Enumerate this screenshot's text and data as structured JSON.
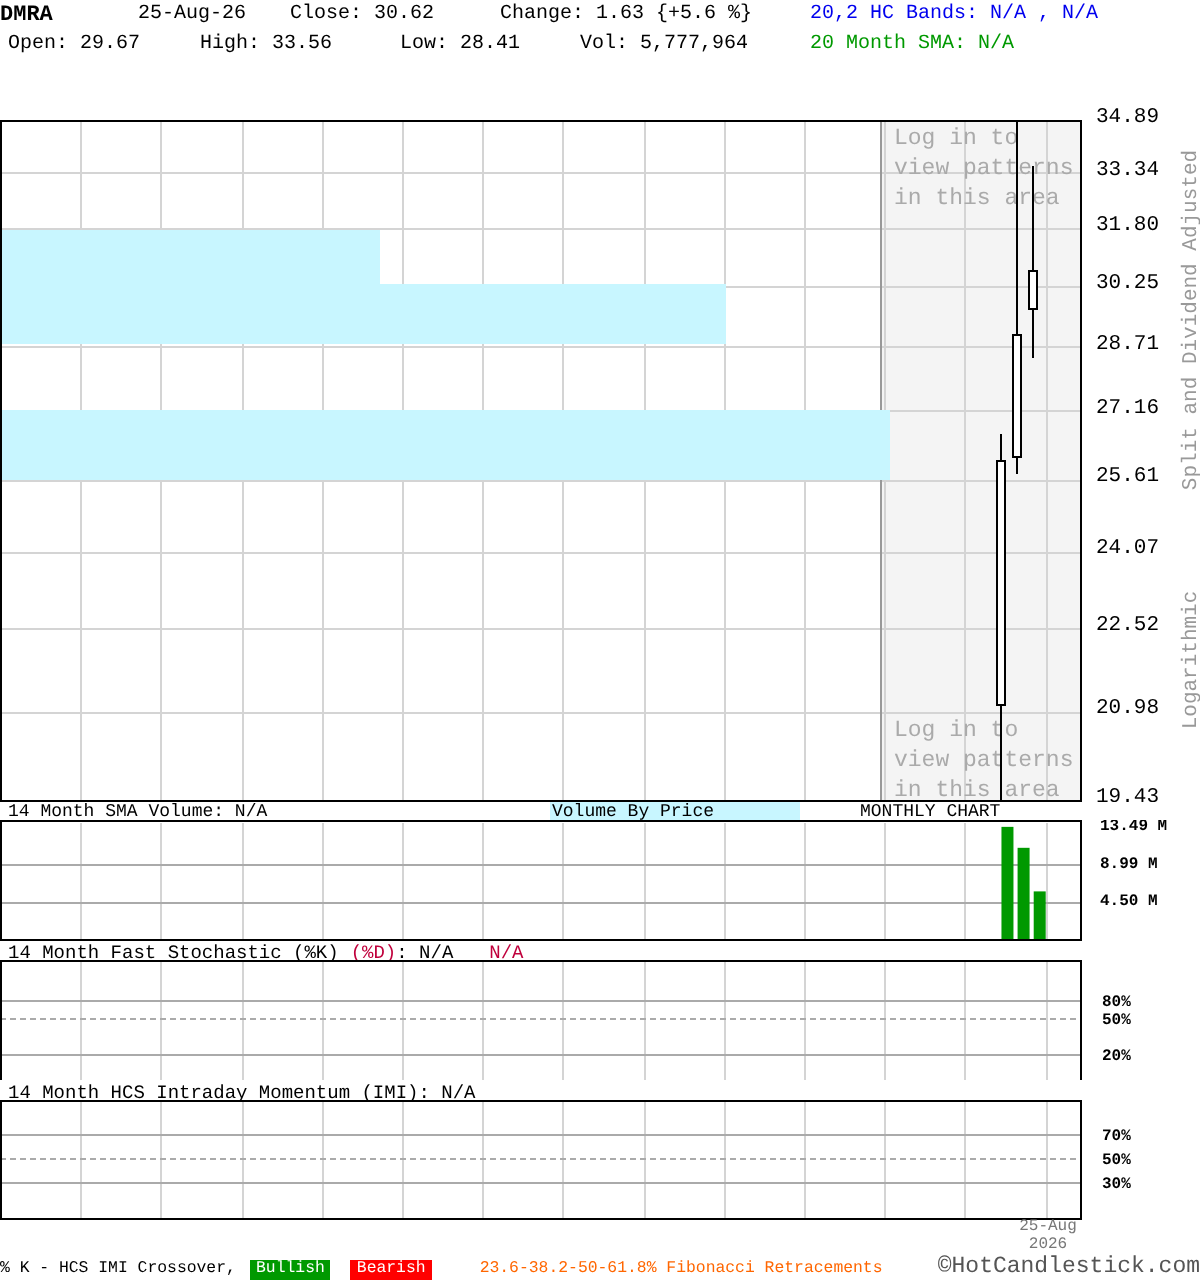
{
  "header": {
    "symbol": "DMRA",
    "date": "25-Aug-26",
    "close": "Close: 30.62",
    "change": "Change: 1.63 {+5.6 %}",
    "open": "Open: 29.67",
    "high": "High: 33.56",
    "low": "Low: 28.41",
    "volume": "Vol: 5,777,964",
    "hc_bands": "20,2 HC Bands: N/A , N/A",
    "sma": "20 Month SMA: N/A"
  },
  "price_chart": {
    "ticks": [
      "34.89",
      "33.34",
      "31.80",
      "30.25",
      "28.71",
      "27.16",
      "25.61",
      "24.07",
      "22.52",
      "20.98",
      "19.43"
    ],
    "side_labels": [
      "Split and Dividend Adjusted",
      "Logarithmic"
    ],
    "pattern_notices": [
      "Log in to view patterns in this area",
      "Log in to view patterns in this area"
    ]
  },
  "volume_panel": {
    "title": "14 Month SMA Volume: N/A",
    "volume_by_price": "Volume By Price",
    "chart_type": "MONTHLY CHART",
    "chart_data": {
      "type": "bar",
      "values": [
        null,
        null,
        null,
        null,
        null,
        null,
        null,
        null,
        null,
        null,
        null,
        null,
        null,
        null,
        null,
        null,
        null,
        null,
        null,
        null,
        null,
        null,
        null,
        null,
        null,
        null,
        null,
        null,
        null,
        null,
        null,
        null,
        null,
        null,
        null,
        null,
        null,
        null,
        null,
        null,
        null,
        null,
        null,
        null,
        null,
        null,
        null,
        null,
        null,
        null,
        null,
        null,
        null,
        null,
        null,
        null,
        null,
        null,
        null,
        null,
        null,
        null,
        13.5,
        11.0,
        5.8,
        null,
        null
      ],
      "ylim": [
        0,
        14.2
      ],
      "yticks": [
        {
          "value": 4.5,
          "label": "4.50 M"
        },
        {
          "value": 8.99,
          "label": "8.99 M"
        },
        {
          "value": 13.49,
          "label": "13.49 M"
        }
      ]
    }
  },
  "stochastic_panel": {
    "kind": "stochastic",
    "title": "14 Month Fast Stochastic (%K)",
    "d_label": "(%D)",
    "k_value": ": N/A",
    "d_value": "N/A",
    "ticks": [
      "80%",
      "50%",
      "20%"
    ]
  },
  "momentum_panel": {
    "kind": "momentum",
    "title": "14 Month HCS Intraday Momentum (IMI): N/A",
    "ticks": [
      "70%",
      "50%",
      "30%"
    ],
    "date_label": "25-Aug 2026"
  },
  "footer": {
    "legend": "% K - HCS IMI Crossover,",
    "bullish": "Bullish",
    "bearish": "Bearish",
    "fibonacci": "23.6-38.2-50-61.8% Fibonacci Retracements",
    "copyright": "©HotCandlestick.com"
  }
}
